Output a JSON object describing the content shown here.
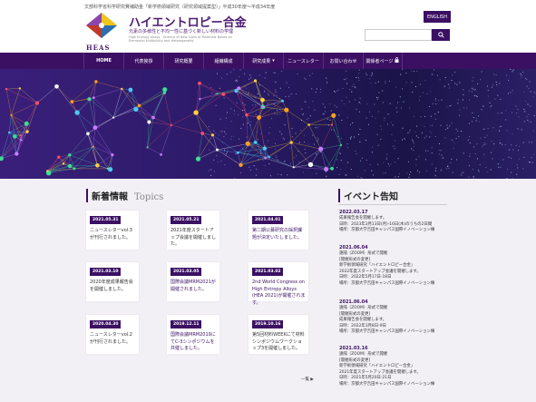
{
  "header": {
    "notice": "文部科学省科学研究費補助金「新学術領域研究（研究領域提案型）」平成30年度〜平成34年度",
    "logo_text": "HEAS",
    "title": "ハイエントロピー合金",
    "subtitle": "元素の多様性と不均一性に基づく新しい材料の学理",
    "subtitle_en_1": "High Entropy Alloys - Science of New Class of Materials Based on",
    "subtitle_en_2": "Elemental Multiplicity and Heterogeneity",
    "english_label": "ENGLISH",
    "search_placeholder": ""
  },
  "nav": [
    {
      "label": "HOME",
      "icon": ""
    },
    {
      "label": "代表挨拶",
      "icon": ""
    },
    {
      "label": "研究概要",
      "icon": ""
    },
    {
      "label": "組織構成",
      "icon": ""
    },
    {
      "label": "研究成果",
      "icon": "caret-down-icon"
    },
    {
      "label": "ニュースレター",
      "icon": ""
    },
    {
      "label": "お問い合わせ",
      "icon": ""
    },
    {
      "label": "関係者ページ",
      "icon": "lock-icon"
    }
  ],
  "topics": {
    "title": "新着情報",
    "title_en": "Topics",
    "more": "一覧 ▶",
    "cards": [
      {
        "date": "2021.05.31",
        "text": "ニュースレターvol.3が刊行されました。",
        "link": false
      },
      {
        "date": "2021.05.21",
        "text": "2021年度スタートアップ会議を開催しました。",
        "link": false
      },
      {
        "date": "2021.04.01",
        "text": "第二期公募研究の採択課題が決定いたしました。",
        "link": true
      },
      {
        "date": "2021.03.10",
        "text": "2020年度成果報告会を開催しました。",
        "link": false
      },
      {
        "date": "2021.03.05",
        "text": "国際会議MRM2021が開催されました。",
        "link": true
      },
      {
        "date": "2021.03.02",
        "text": "2nd World Congress on High Entropy Alloys (HEA 2021)が開催されます。",
        "link": true
      },
      {
        "date": "2020.04.30",
        "text": "ニュースレターvol.2が刊行されました。",
        "link": false
      },
      {
        "date": "2019.12.11",
        "text": "国際会議MRM2019にてC-3シンポジウムを共催しました。",
        "link": true
      },
      {
        "date": "2019.10.16",
        "text": "第5回材料WEEKにて材料シンポジウムワークショップ3を開催しました。",
        "link": false
      }
    ]
  },
  "events": {
    "title": "イベント告知",
    "items": [
      {
        "date": "2022.03.17",
        "lines": [
          "成果報告会を開催します。",
          "日時：2023年3月13日(月)-16日(木)のうちの2日間",
          "場所：京都大学吉田キャンパス国際イノベーション棟"
        ]
      },
      {
        "date": "2021.06.04",
        "lines": [
          "遠隔（ZOOM）形式で開催",
          "[開催形式の変更]",
          "新学術領域研究「ハイエントロピー合金」",
          "2022年度スタートアップ会議を開催します。",
          "日時：2022年5月17日-18日",
          "場所：京都大学吉田キャンパス国際イノベーション棟"
        ]
      },
      {
        "date": "2021.06.04",
        "lines": [
          "遠隔（ZOOM）形式で開催",
          "[開催形式の変更]",
          "成果報告会を開催します。",
          "日時：2022年3月8日-9日",
          "場所：京都大学吉田キャンパス国際イノベーション棟"
        ]
      },
      {
        "date": "2021.03.16",
        "lines": [
          "遠隔（ZOOM）形式で開催",
          "[開催形式の変更]",
          "新学術領域研究「ハイエントロピー合金」",
          "2021年度スタートアップ会議を開催します。",
          "日時：2021年5月20日-21日",
          "場所：京都大学吉田キャンパス国際イノベーション棟"
        ]
      }
    ]
  },
  "colors": {
    "brand": "#3b1063",
    "background": "#f2f0f5"
  }
}
